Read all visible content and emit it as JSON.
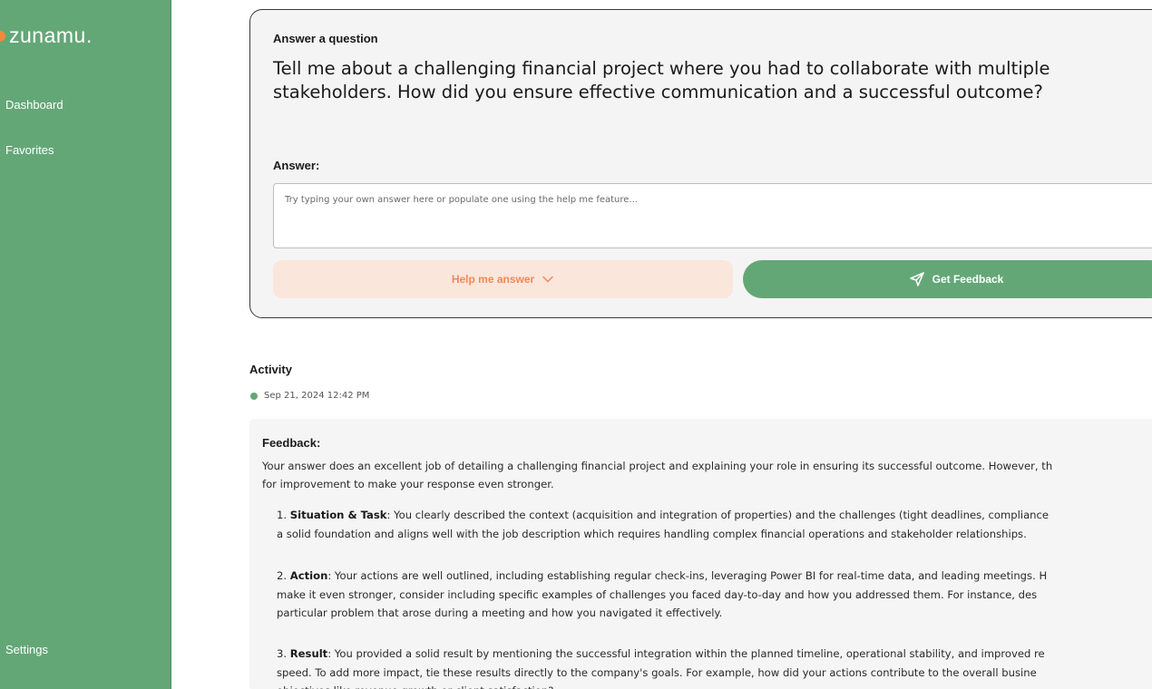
{
  "sidebar": {
    "logo": "zunamu.",
    "nav": {
      "dashboard": "Dashboard",
      "favorites": "Favorites",
      "settings": "Settings"
    }
  },
  "question_card": {
    "label": "Answer a question",
    "question": "Tell me about a challenging financial project where you had to collaborate with multiple stakeholders. How did you ensure effective communication and a successful outcome?",
    "answer_label": "Answer:",
    "answer_placeholder": "Try typing your own answer here or populate one using the help me feature...",
    "help_button": "Help me answer",
    "feedback_button": "Get Feedback"
  },
  "activity": {
    "title": "Activity",
    "date": "Sep 21, 2024 12:42 PM",
    "feedback_title": "Feedback:",
    "intro_lines": [
      "Your answer does an excellent job of detailing a challenging financial project and explaining your role in ensuring its successful outcome. However, th",
      "for improvement to make your response even stronger."
    ],
    "items": [
      {
        "num": "1.",
        "heading": "Situation & Task",
        "first": ": You clearly described the context (acquisition and integration of properties) and the challenges (tight deadlines, compliance",
        "rest": [
          "a solid foundation and aligns well with the job description which requires handling complex financial operations and stakeholder relationships."
        ]
      },
      {
        "num": "2.",
        "heading": "Action",
        "first": ": Your actions are well outlined, including establishing regular check-ins, leveraging Power BI for real-time data, and leading meetings. H",
        "rest": [
          "make it even stronger, consider including specific examples of challenges you faced day-to-day and how you addressed them. For instance, des",
          "particular problem that arose during a meeting and how you navigated it effectively."
        ]
      },
      {
        "num": "3.",
        "heading": "Result",
        "first": ": You provided a solid result by mentioning the successful integration within the planned timeline, operational stability, and improved re",
        "rest": [
          "speed. To add more impact, tie these results directly to the company's goals. For example, how did your actions contribute to the overall busine",
          "objectives like revenue growth or client satisfaction?"
        ]
      }
    ]
  },
  "colors": {
    "brand_green": "#64a777",
    "accent_orange": "#f0885a",
    "help_bg": "#fbe6dc"
  },
  "icons": {
    "help": "chevron-down-icon",
    "feedback": "send-icon",
    "status": "status-dot-icon"
  }
}
